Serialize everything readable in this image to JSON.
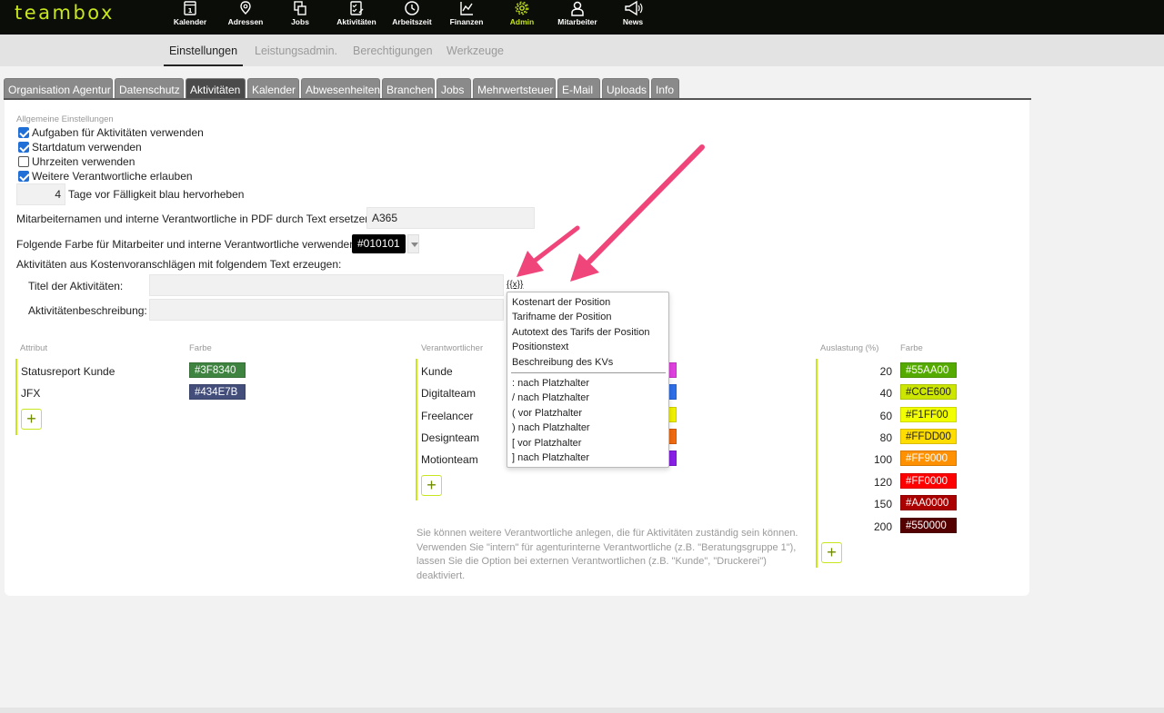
{
  "app": {
    "logo": "teambox"
  },
  "nav": [
    {
      "label": "Kalender",
      "icon": "calendar-icon"
    },
    {
      "label": "Adressen",
      "icon": "location-pin-icon"
    },
    {
      "label": "Jobs",
      "icon": "jobs-icon"
    },
    {
      "label": "Aktivitäten",
      "icon": "checklist-icon"
    },
    {
      "label": "Arbeitszeit",
      "icon": "clock-icon"
    },
    {
      "label": "Finanzen",
      "icon": "chart-icon"
    },
    {
      "label": "Admin",
      "icon": "gear-icon",
      "active": true
    },
    {
      "label": "Mitarbeiter",
      "icon": "person-icon"
    },
    {
      "label": "News",
      "icon": "megaphone-icon"
    }
  ],
  "subnav": [
    "Einstellungen",
    "Leistungsadmin.",
    "Berechtigungen",
    "Werkzeuge"
  ],
  "tabs": [
    "Organisation Agentur",
    "Datenschutz",
    "Aktivitäten",
    "Kalender",
    "Abwesenheiten",
    "Branchen",
    "Jobs",
    "Mehrwertsteuer",
    "E-Mail",
    "Uploads",
    "Info"
  ],
  "general": {
    "heading": "Allgemeine Einstellungen",
    "checkboxes": [
      {
        "label": "Aufgaben für Aktivitäten verwenden",
        "checked": true
      },
      {
        "label": "Startdatum verwenden",
        "checked": true
      },
      {
        "label": "Uhrzeiten verwenden",
        "checked": false
      },
      {
        "label": "Weitere Verantwortliche erlauben",
        "checked": true
      }
    ],
    "days_value": "4",
    "days_label": "Tage vor Fälligkeit blau hervorheben",
    "pdf_label": "Mitarbeiternamen und interne Verantwortliche in PDF durch Text ersetzen",
    "pdf_value": "A365",
    "color_label": "Folgende Farbe für Mitarbeiter und interne Verantwortliche verwenden",
    "color_value": "#010101",
    "kv_label": "Aktivitäten aus Kostenvoranschlägen mit folgendem Text erzeugen:",
    "title_label": "Titel der Aktivitäten:",
    "title_value": "",
    "desc_label": "Aktivitätenbeschreibung:",
    "desc_value": "",
    "placeholder_button": "{{x}}"
  },
  "attributes": {
    "col_attr": "Attribut",
    "col_color": "Farbe",
    "items": [
      {
        "name": "Statusreport Kunde",
        "color": "#3F8340"
      },
      {
        "name": "JFX",
        "color": "#434E7B"
      }
    ],
    "add": "+"
  },
  "responsibles": {
    "col_name": "Verantwortlicher",
    "items": [
      {
        "name": "Kunde",
        "color": "#E040E0"
      },
      {
        "name": "Digitalteam",
        "color": "#2F6FE8"
      },
      {
        "name": "Freelancer",
        "color": "#F0F000"
      },
      {
        "name": "Designteam",
        "color": "#F06A10"
      },
      {
        "name": "Motionteam",
        "color": "#8A20E8"
      }
    ],
    "add": "+",
    "hint": "Sie können weitere Verantwortliche anlegen, die für Aktivitäten zuständig sein können. Verwenden Sie \"intern\" für agenturinterne Verantwortliche (z.B. \"Beratungsgruppe 1\"), lassen Sie die Option bei externen Verantwortlichen (z.B. \"Kunde\", \"Druckerei\") deaktiviert."
  },
  "utilization": {
    "col_pct": "Auslastung (%)",
    "col_color": "Farbe",
    "items": [
      {
        "pct": "20",
        "color": "#55AA00",
        "text_color": "#ffffff"
      },
      {
        "pct": "40",
        "color": "#CCE600",
        "text_color": "#222222"
      },
      {
        "pct": "60",
        "color": "#F1FF00",
        "text_color": "#222222"
      },
      {
        "pct": "80",
        "color": "#FFDD00",
        "text_color": "#222222"
      },
      {
        "pct": "100",
        "color": "#FF9000",
        "text_color": "#ffffff"
      },
      {
        "pct": "120",
        "color": "#FF0000",
        "text_color": "#ffffff"
      },
      {
        "pct": "150",
        "color": "#AA0000",
        "text_color": "#ffffff"
      },
      {
        "pct": "200",
        "color": "#550000",
        "text_color": "#ffffff"
      }
    ],
    "add": "+"
  },
  "placeholder_menu": {
    "fields": [
      "Kostenart der Position",
      "Tarifname der Position",
      "Autotext des Tarifs der Position",
      "Positionstext",
      "Beschreibung des KVs"
    ],
    "modifiers": [
      ": nach Platzhalter",
      "/ nach Platzhalter",
      "( vor Platzhalter",
      ") nach Platzhalter",
      "[ vor Platzhalter",
      "] nach Platzhalter"
    ]
  },
  "colors": {
    "accent": "#c8e51e",
    "annotation_arrow": "#f0457a"
  }
}
